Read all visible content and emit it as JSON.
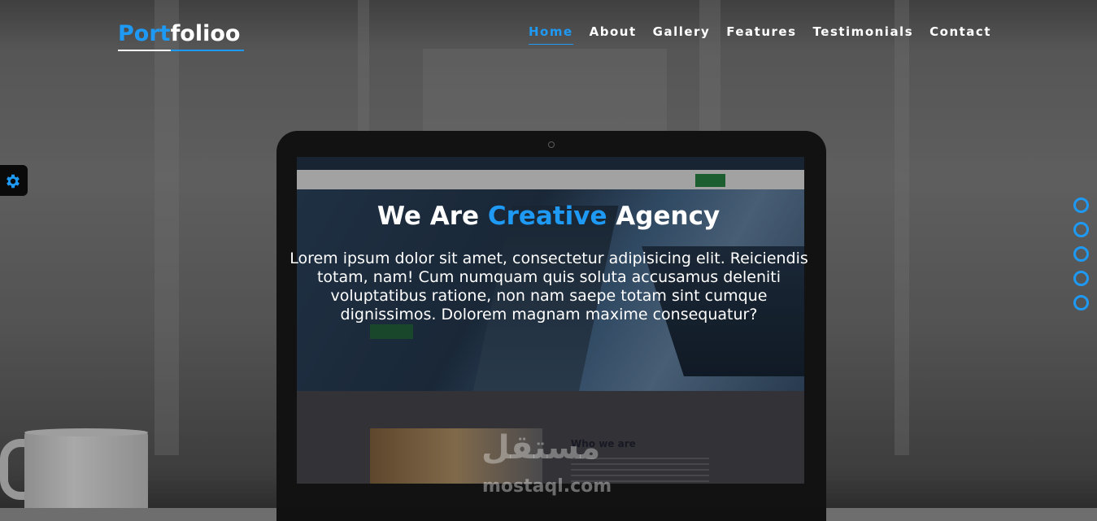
{
  "header": {
    "logo_part1": "Port",
    "logo_part2": "folioo",
    "nav": [
      {
        "label": "Home",
        "active": true
      },
      {
        "label": "About"
      },
      {
        "label": "Gallery"
      },
      {
        "label": "Features"
      },
      {
        "label": "Testimonials"
      },
      {
        "label": "Contact"
      }
    ]
  },
  "hero": {
    "title_part1": "We Are",
    "title_accent": "Creative",
    "title_part2": "Agency",
    "text": "Lorem ipsum dolor sit amet, consectetur adipisicing elit. Reiciendis totam, nam! Cum numquam quis soluta accusamus deleniti voluptatibus ratione, non nam saepe totam sint cumque dignissimos. Dolorem magnam maxime consequatur?"
  },
  "laptop_screen": {
    "who_we_are": "Who we are"
  },
  "watermark": {
    "arabic": "مستقل",
    "latin": "mostaql.com"
  },
  "colors": {
    "accent": "#1e9af5"
  },
  "icons": {
    "settings": "gear-icon"
  }
}
